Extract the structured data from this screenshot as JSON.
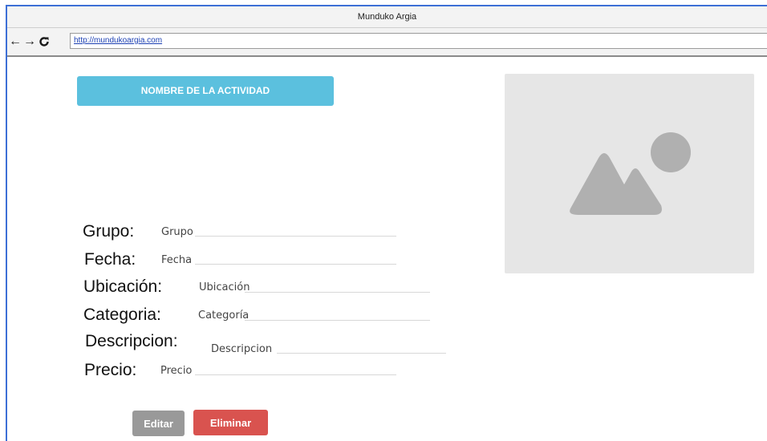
{
  "window": {
    "title": "Munduko Argia"
  },
  "nav": {
    "back_icon": "arrow-left-icon",
    "forward_icon": "arrow-right-icon",
    "refresh_icon": "refresh-icon",
    "url": "http://mundukoargia.com"
  },
  "activity": {
    "title": "NOMBRE DE LA ACTIVIDAD"
  },
  "image": {
    "icon": "image-placeholder-icon"
  },
  "fields": {
    "grupo": {
      "label": "Grupo:",
      "value": "Grupo"
    },
    "fecha": {
      "label": "Fecha:",
      "value": "Fecha"
    },
    "ubicacion": {
      "label": "Ubicación:",
      "value": "Ubicación"
    },
    "categoria": {
      "label": "Categoria:",
      "value": "Categoría"
    },
    "descripcion": {
      "label": "Descripcion:",
      "value": "Descripcion"
    },
    "precio": {
      "label": "Precio:",
      "value": "Precio"
    }
  },
  "actions": {
    "edit_label": "Editar",
    "delete_label": "Eliminar"
  },
  "colors": {
    "accent_title": "#5bc0de",
    "edit_button": "#999999",
    "delete_button": "#d9534f",
    "window_border": "#3d6fd6"
  }
}
